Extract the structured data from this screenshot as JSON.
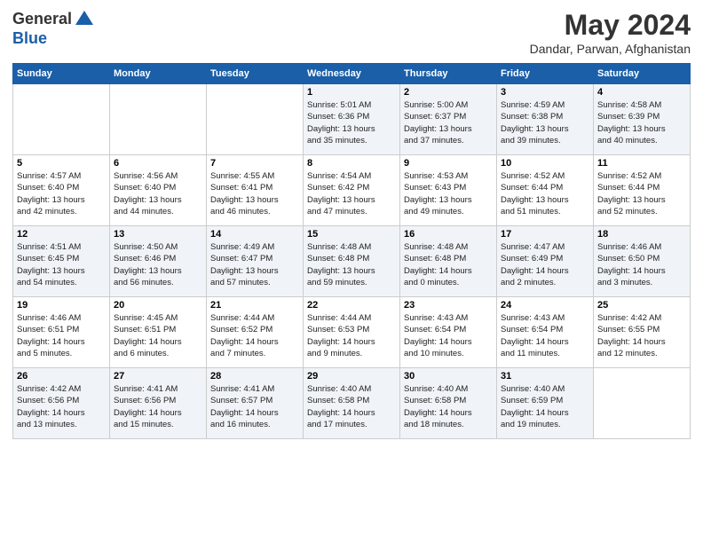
{
  "logo": {
    "general": "General",
    "blue": "Blue"
  },
  "title": "May 2024",
  "location": "Dandar, Parwan, Afghanistan",
  "weekdays": [
    "Sunday",
    "Monday",
    "Tuesday",
    "Wednesday",
    "Thursday",
    "Friday",
    "Saturday"
  ],
  "weeks": [
    [
      {
        "day": "",
        "info": ""
      },
      {
        "day": "",
        "info": ""
      },
      {
        "day": "",
        "info": ""
      },
      {
        "day": "1",
        "info": "Sunrise: 5:01 AM\nSunset: 6:36 PM\nDaylight: 13 hours\nand 35 minutes."
      },
      {
        "day": "2",
        "info": "Sunrise: 5:00 AM\nSunset: 6:37 PM\nDaylight: 13 hours\nand 37 minutes."
      },
      {
        "day": "3",
        "info": "Sunrise: 4:59 AM\nSunset: 6:38 PM\nDaylight: 13 hours\nand 39 minutes."
      },
      {
        "day": "4",
        "info": "Sunrise: 4:58 AM\nSunset: 6:39 PM\nDaylight: 13 hours\nand 40 minutes."
      }
    ],
    [
      {
        "day": "5",
        "info": "Sunrise: 4:57 AM\nSunset: 6:40 PM\nDaylight: 13 hours\nand 42 minutes."
      },
      {
        "day": "6",
        "info": "Sunrise: 4:56 AM\nSunset: 6:40 PM\nDaylight: 13 hours\nand 44 minutes."
      },
      {
        "day": "7",
        "info": "Sunrise: 4:55 AM\nSunset: 6:41 PM\nDaylight: 13 hours\nand 46 minutes."
      },
      {
        "day": "8",
        "info": "Sunrise: 4:54 AM\nSunset: 6:42 PM\nDaylight: 13 hours\nand 47 minutes."
      },
      {
        "day": "9",
        "info": "Sunrise: 4:53 AM\nSunset: 6:43 PM\nDaylight: 13 hours\nand 49 minutes."
      },
      {
        "day": "10",
        "info": "Sunrise: 4:52 AM\nSunset: 6:44 PM\nDaylight: 13 hours\nand 51 minutes."
      },
      {
        "day": "11",
        "info": "Sunrise: 4:52 AM\nSunset: 6:44 PM\nDaylight: 13 hours\nand 52 minutes."
      }
    ],
    [
      {
        "day": "12",
        "info": "Sunrise: 4:51 AM\nSunset: 6:45 PM\nDaylight: 13 hours\nand 54 minutes."
      },
      {
        "day": "13",
        "info": "Sunrise: 4:50 AM\nSunset: 6:46 PM\nDaylight: 13 hours\nand 56 minutes."
      },
      {
        "day": "14",
        "info": "Sunrise: 4:49 AM\nSunset: 6:47 PM\nDaylight: 13 hours\nand 57 minutes."
      },
      {
        "day": "15",
        "info": "Sunrise: 4:48 AM\nSunset: 6:48 PM\nDaylight: 13 hours\nand 59 minutes."
      },
      {
        "day": "16",
        "info": "Sunrise: 4:48 AM\nSunset: 6:48 PM\nDaylight: 14 hours\nand 0 minutes."
      },
      {
        "day": "17",
        "info": "Sunrise: 4:47 AM\nSunset: 6:49 PM\nDaylight: 14 hours\nand 2 minutes."
      },
      {
        "day": "18",
        "info": "Sunrise: 4:46 AM\nSunset: 6:50 PM\nDaylight: 14 hours\nand 3 minutes."
      }
    ],
    [
      {
        "day": "19",
        "info": "Sunrise: 4:46 AM\nSunset: 6:51 PM\nDaylight: 14 hours\nand 5 minutes."
      },
      {
        "day": "20",
        "info": "Sunrise: 4:45 AM\nSunset: 6:51 PM\nDaylight: 14 hours\nand 6 minutes."
      },
      {
        "day": "21",
        "info": "Sunrise: 4:44 AM\nSunset: 6:52 PM\nDaylight: 14 hours\nand 7 minutes."
      },
      {
        "day": "22",
        "info": "Sunrise: 4:44 AM\nSunset: 6:53 PM\nDaylight: 14 hours\nand 9 minutes."
      },
      {
        "day": "23",
        "info": "Sunrise: 4:43 AM\nSunset: 6:54 PM\nDaylight: 14 hours\nand 10 minutes."
      },
      {
        "day": "24",
        "info": "Sunrise: 4:43 AM\nSunset: 6:54 PM\nDaylight: 14 hours\nand 11 minutes."
      },
      {
        "day": "25",
        "info": "Sunrise: 4:42 AM\nSunset: 6:55 PM\nDaylight: 14 hours\nand 12 minutes."
      }
    ],
    [
      {
        "day": "26",
        "info": "Sunrise: 4:42 AM\nSunset: 6:56 PM\nDaylight: 14 hours\nand 13 minutes."
      },
      {
        "day": "27",
        "info": "Sunrise: 4:41 AM\nSunset: 6:56 PM\nDaylight: 14 hours\nand 15 minutes."
      },
      {
        "day": "28",
        "info": "Sunrise: 4:41 AM\nSunset: 6:57 PM\nDaylight: 14 hours\nand 16 minutes."
      },
      {
        "day": "29",
        "info": "Sunrise: 4:40 AM\nSunset: 6:58 PM\nDaylight: 14 hours\nand 17 minutes."
      },
      {
        "day": "30",
        "info": "Sunrise: 4:40 AM\nSunset: 6:58 PM\nDaylight: 14 hours\nand 18 minutes."
      },
      {
        "day": "31",
        "info": "Sunrise: 4:40 AM\nSunset: 6:59 PM\nDaylight: 14 hours\nand 19 minutes."
      },
      {
        "day": "",
        "info": ""
      }
    ]
  ]
}
